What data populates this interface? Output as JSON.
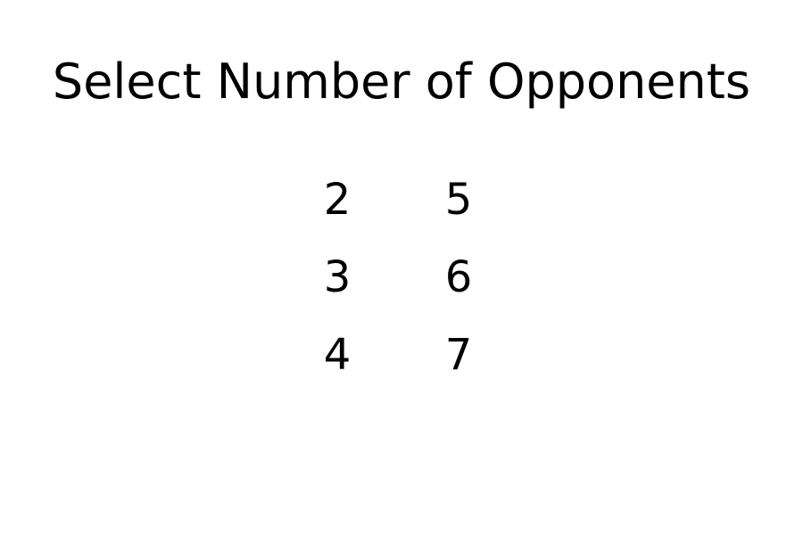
{
  "title": "Select Number of Opponents",
  "options": [
    "2",
    "3",
    "4",
    "5",
    "6",
    "7"
  ]
}
